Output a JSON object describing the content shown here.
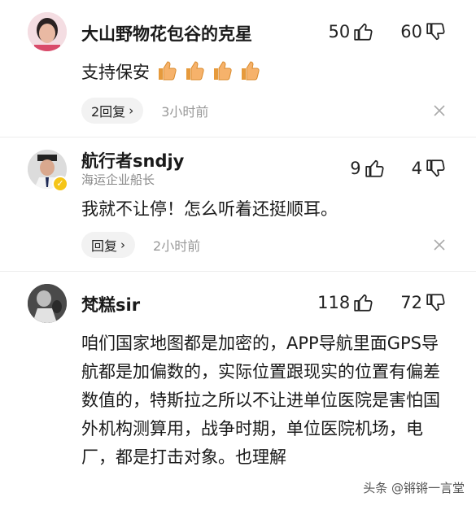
{
  "comments": [
    {
      "username": "大山野物花包谷的克星",
      "subtitle": "",
      "likes": "50",
      "dislikes": "60",
      "text": "支持保安",
      "emoji_count": 4,
      "reply_label": "2回复",
      "time": "3小时前"
    },
    {
      "username": "航行者sndjy",
      "subtitle": "海运企业船长",
      "likes": "9",
      "dislikes": "4",
      "text": "我就不让停！怎么听着还挺顺耳。",
      "reply_label": "回复",
      "time": "2小时前"
    },
    {
      "username": "梵糕sir",
      "subtitle": "",
      "likes": "118",
      "dislikes": "72",
      "text": "咱们国家地图都是加密的，APP导航里面GPS导航都是加偏数的，实际位置跟现实的位置有偏差数值的，特斯拉之所以不让进单位医院是害怕国外机构测算用，战争时期，单位医院机场，电厂，都是打击对象。也理解"
    }
  ],
  "watermark": "头条 @锵锵一言堂",
  "colors": {
    "text": "#1a1a1a",
    "muted": "#999999",
    "reply_bg": "#f2f2f2",
    "badge": "#f5c518",
    "emoji_thumb": "#f6b26b"
  },
  "icons": [
    "thumb-up-icon",
    "thumb-down-icon",
    "close-icon",
    "chevron-right-icon",
    "verified-badge-icon"
  ]
}
